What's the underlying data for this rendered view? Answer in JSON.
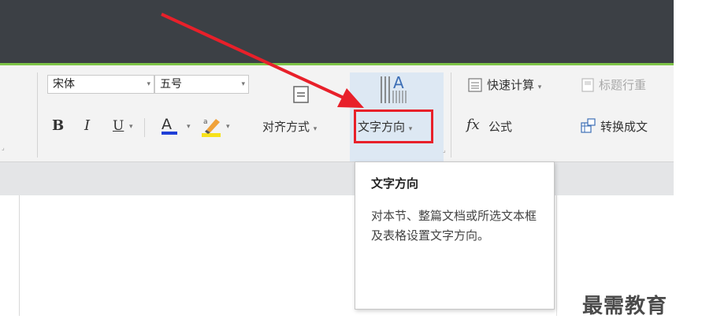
{
  "font": {
    "family": "宋体",
    "size": "五号"
  },
  "format_buttons": {
    "bold": "B",
    "italic": "I",
    "underline": "U",
    "font_color": "A"
  },
  "align_button": {
    "label": "对齐方式"
  },
  "text_direction_button": {
    "label": "文字方向",
    "icon_glyph": "A"
  },
  "calc": {
    "quick_calc": "快速计算",
    "header_row": "标题行重",
    "formula_prefix": "fx",
    "formula": "公式",
    "convert": "转换成文"
  },
  "tooltip": {
    "title": "文字方向",
    "body": "对本节、整篇文档或所选文本框及表格设置文字方向。"
  },
  "watermark": "最需教育",
  "colors": {
    "accent_green": "#7ec447",
    "title_dark": "#3c4045",
    "highlight_red": "#e8202a",
    "hover_blue": "#dde8f3"
  }
}
